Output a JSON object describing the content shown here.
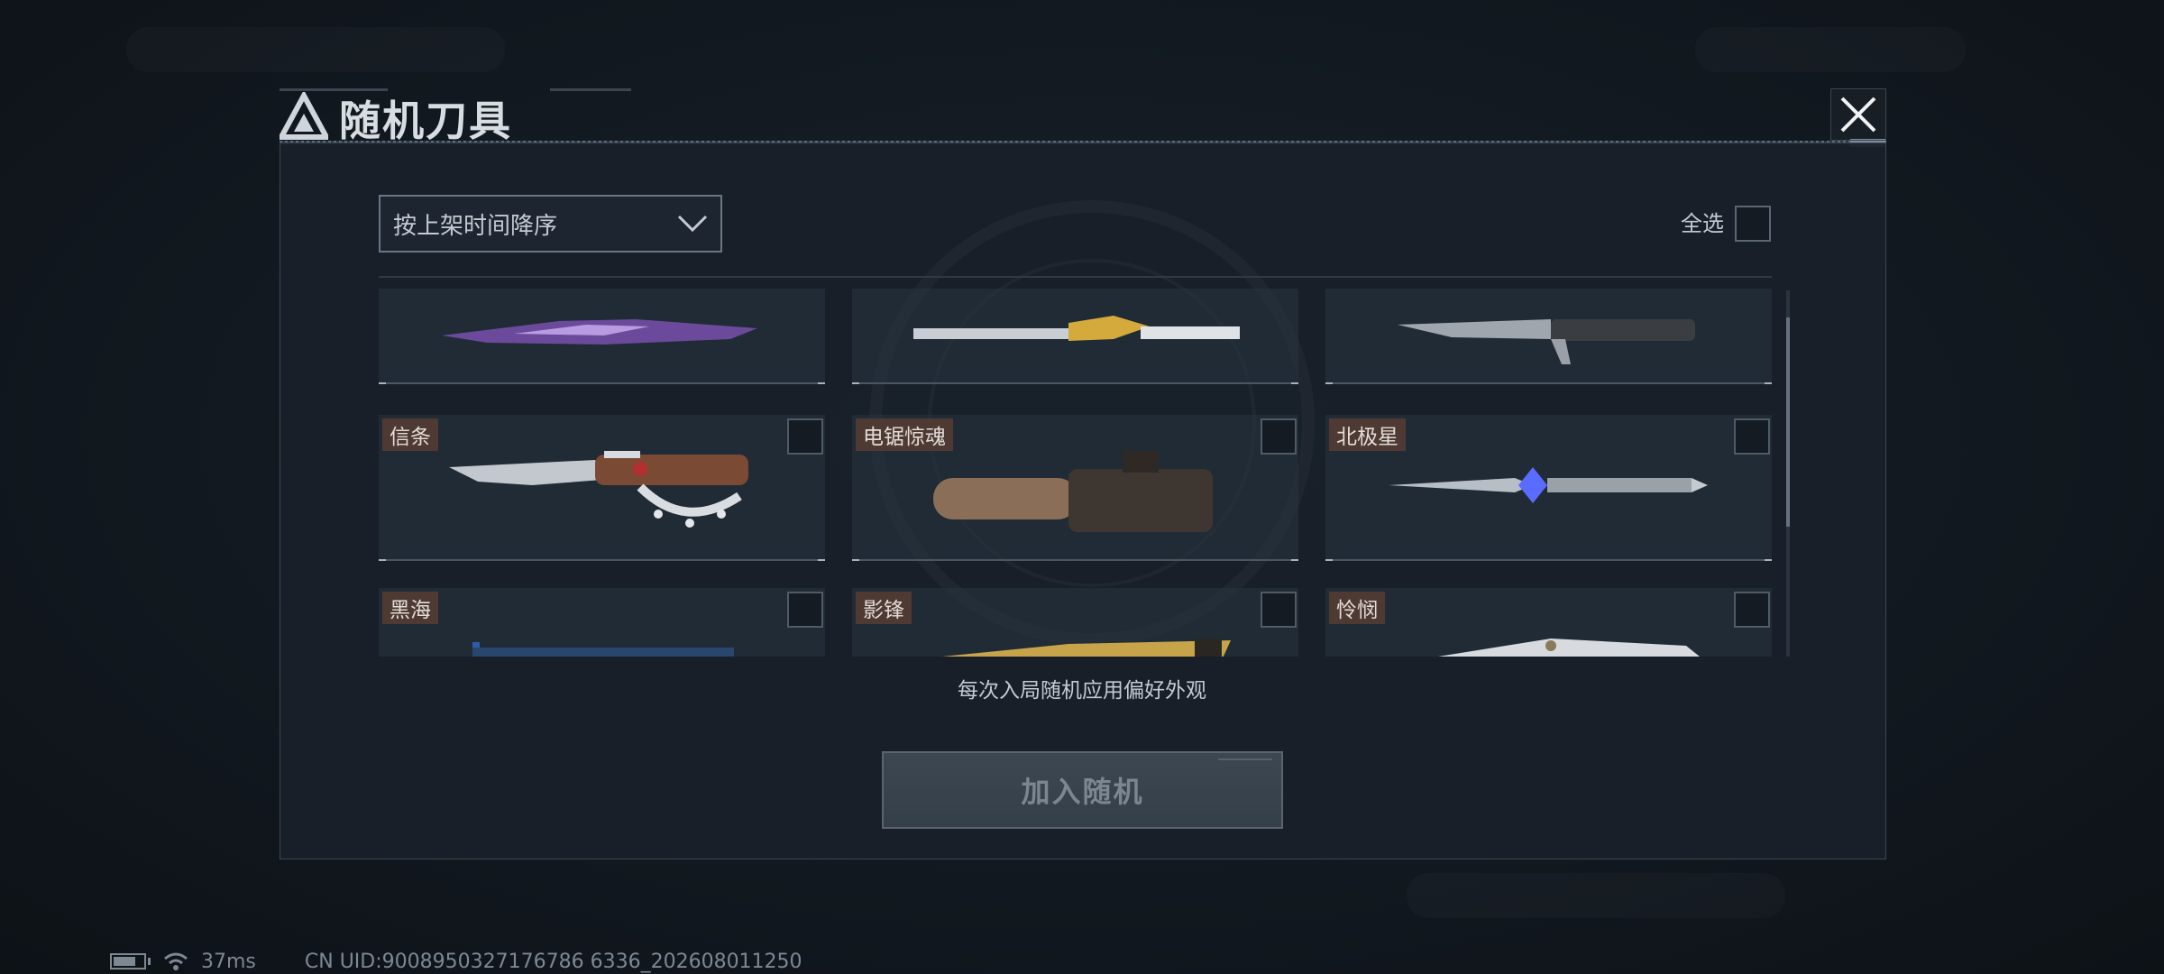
{
  "dialog": {
    "title": "随机刀具",
    "close_icon": "close-icon"
  },
  "toolbar": {
    "sort_label": "按上架时间降序",
    "select_all_label": "全选"
  },
  "items": [
    {
      "name": "",
      "knife": "purple-blade",
      "checked": false
    },
    {
      "name": "",
      "knife": "gold-blade",
      "checked": false
    },
    {
      "name": "",
      "knife": "combat-blade",
      "checked": false
    },
    {
      "name": "信条",
      "knife": "knuckle-blade",
      "checked": false
    },
    {
      "name": "电锯惊魂",
      "knife": "chainsaw",
      "checked": false
    },
    {
      "name": "北极星",
      "knife": "star-blade",
      "checked": false
    },
    {
      "name": "黑海",
      "knife": "blue-blade",
      "checked": false
    },
    {
      "name": "影锋",
      "knife": "shadow-blade",
      "checked": false
    },
    {
      "name": "怜悯",
      "knife": "mercy-blade",
      "checked": false
    }
  ],
  "hint": "每次入局随机应用偏好外观",
  "join_button": "加入随机",
  "status": {
    "ping": "37ms",
    "uid": "CN UID:9008950327176786 6336_202608011250"
  }
}
